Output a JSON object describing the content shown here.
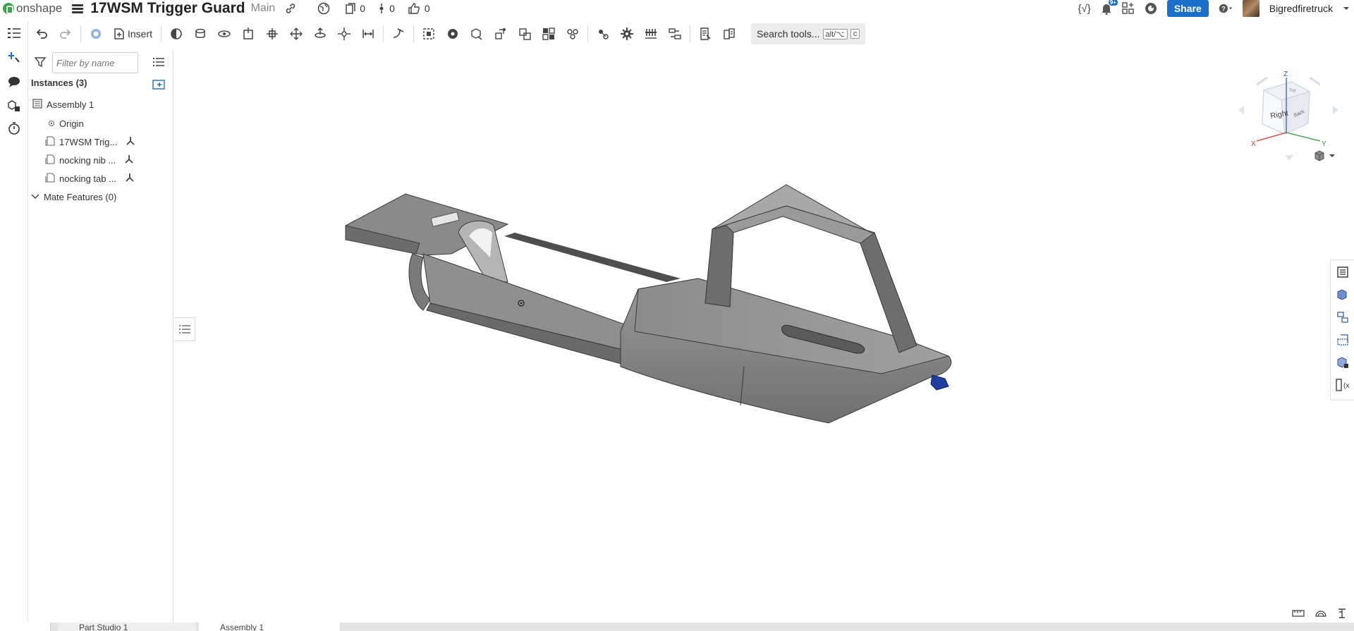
{
  "app": {
    "brand": "onshape",
    "document_title": "17WSM Trigger Guard",
    "branch": "Main"
  },
  "header": {
    "counters": [
      {
        "icon": "versions-icon",
        "value": "0"
      },
      {
        "icon": "branch-icon",
        "value": "0"
      },
      {
        "icon": "thumbs-up-icon",
        "value": "0"
      }
    ],
    "notification_badge": "9+",
    "share_label": "Share",
    "username": "Bigredfiretruck"
  },
  "toolbar": {
    "insert_label": "Insert",
    "search_label": "Search tools...",
    "search_shortcut_1": "alt/⌥",
    "search_shortcut_2": "c"
  },
  "panel": {
    "filter_placeholder": "Filter by name",
    "instances_header": "Instances (3)",
    "tree": [
      {
        "label": "Assembly 1"
      },
      {
        "label": "Origin"
      },
      {
        "label": "17WSM Trig..."
      },
      {
        "label": "nocking nib ..."
      },
      {
        "label": "nocking tab ..."
      }
    ],
    "mate_features": "Mate Features (0)"
  },
  "viewcube": {
    "face_right": "Right",
    "face_back": "Back",
    "face_top": "Top",
    "axis_x": "X",
    "axis_y": "Y",
    "axis_z": "Z"
  },
  "bottom_tabs": [
    {
      "label": "Part Studio 1"
    },
    {
      "label": "Assembly 1"
    }
  ],
  "colors": {
    "accent": "#1a6fc9",
    "model_gray": "#8a8a8a",
    "model_blue_part": "#1e3fa0"
  }
}
